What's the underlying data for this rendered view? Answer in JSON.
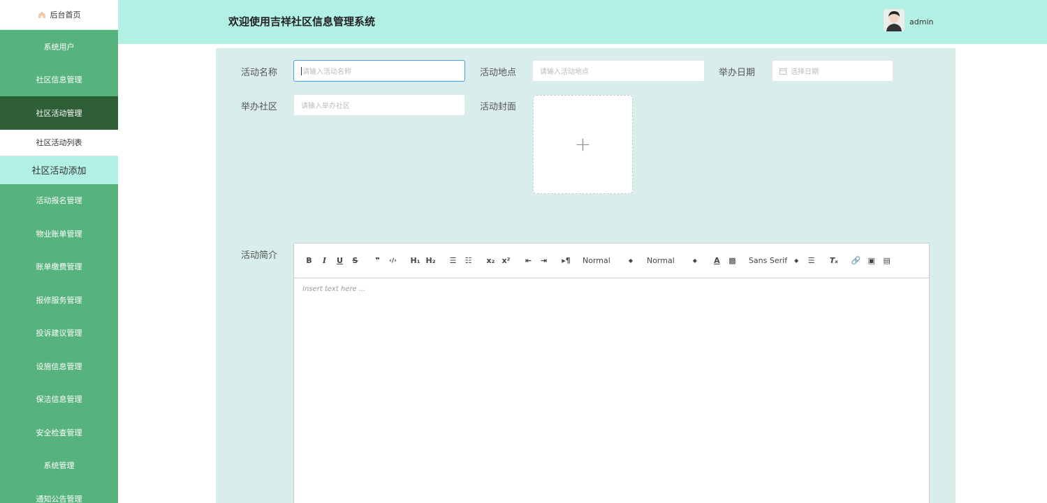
{
  "sidebar": {
    "home": "后台首页",
    "items": [
      {
        "label": "系统用户"
      },
      {
        "label": "社区信息管理"
      },
      {
        "label": "社区活动管理"
      },
      {
        "label": "社区活动列表"
      },
      {
        "label": "社区活动添加"
      },
      {
        "label": "活动报名管理"
      },
      {
        "label": "物业账单管理"
      },
      {
        "label": "账单缴费管理"
      },
      {
        "label": "报修服务管理"
      },
      {
        "label": "投诉建议管理"
      },
      {
        "label": "设施信息管理"
      },
      {
        "label": "保洁信息管理"
      },
      {
        "label": "安全检查管理"
      },
      {
        "label": "系统管理"
      },
      {
        "label": "通知公告管理"
      }
    ]
  },
  "header": {
    "title": "欢迎使用吉祥社区信息管理系统",
    "username": "admin"
  },
  "form": {
    "name_label": "活动名称",
    "name_placeholder": "请输入活动名称",
    "location_label": "活动地点",
    "location_placeholder": "请输入活动地点",
    "date_label": "举办日期",
    "date_placeholder": "选择日期",
    "community_label": "举办社区",
    "community_placeholder": "请输入举办社区",
    "cover_label": "活动封面",
    "cover_plus": "+",
    "intro_label": "活动简介"
  },
  "editor": {
    "header_select": "Normal",
    "size_select": "Normal",
    "font_select": "Sans Serif",
    "placeholder": "Insert text here ..."
  },
  "colors": {
    "sidebar_bg": "#57b37d",
    "sidebar_active": "#2f5f37",
    "header_bg": "#b3f0e4",
    "panel_bg": "#d9eeea",
    "focus_border": "#409eff"
  }
}
